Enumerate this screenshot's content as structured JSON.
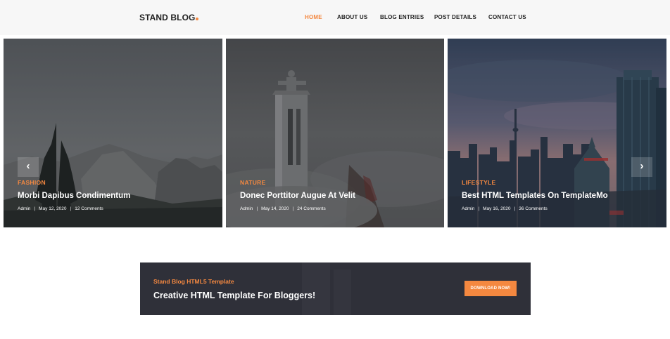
{
  "header": {
    "logo": "STAND BLOG",
    "nav": [
      {
        "label": "HOME",
        "active": true
      },
      {
        "label": "ABOUT US",
        "active": false
      },
      {
        "label": "BLOG ENTRIES",
        "active": false
      },
      {
        "label": "POST DETAILS",
        "active": false
      },
      {
        "label": "CONTACT US",
        "active": false
      }
    ]
  },
  "slides": [
    {
      "category": "FASHION",
      "title": "Morbi Dapibus Condimentum",
      "author": "Admin",
      "date": "May 12, 2020",
      "comments": "12 Comments"
    },
    {
      "category": "NATURE",
      "title": "Donec Porttitor Augue At Velit",
      "author": "Admin",
      "date": "May 14, 2020",
      "comments": "24 Comments"
    },
    {
      "category": "LIFESTYLE",
      "title": "Best HTML Templates On TemplateMo",
      "author": "Admin",
      "date": "May 16, 2020",
      "comments": "36 Comments"
    }
  ],
  "carousel": {
    "prev": "‹",
    "next": "›"
  },
  "cta": {
    "subtitle": "Stand Blog HTML5 Template",
    "title": "Creative HTML Template For Bloggers!",
    "button": "DOWNLOAD NOW!"
  },
  "colors": {
    "accent": "#f48840",
    "dark": "#2f3039",
    "header_bg": "#f7f7f7"
  }
}
